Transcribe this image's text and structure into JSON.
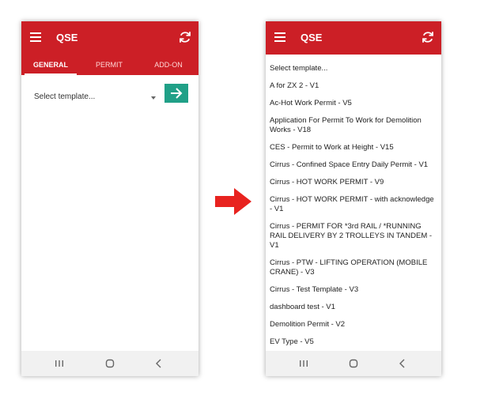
{
  "left_screen": {
    "app_title": "QSE",
    "tabs": [
      {
        "label": "GENERAL",
        "active": true
      },
      {
        "label": "PERMIT",
        "active": false
      },
      {
        "label": "ADD-ON",
        "active": false
      }
    ],
    "select_placeholder": "Select template..."
  },
  "right_screen": {
    "app_title": "QSE",
    "templates": [
      "Select template...",
      "A for ZX 2 - V1",
      "Ac-Hot Work Permit - V5",
      "Application For Permit To Work for Demolition Works - V18",
      "CES - Permit to Work at Height - V15",
      "Cirrus - Confined Space Entry Daily Permit - V1",
      "Cirrus - HOT WORK PERMIT - V9",
      "Cirrus - HOT WORK PERMIT - with acknowledge - V1",
      "Cirrus - PERMIT FOR *3rd RAIL / *RUNNING RAIL DELIVERY BY 2 TROLLEYS IN TANDEM - V1",
      "Cirrus - PTW - LIFTING OPERATION (MOBILE CRANE) - V3",
      "Cirrus - Test Template - V3",
      "dashboard test - V1",
      "Demolition Permit - V2",
      "EV Type - V5"
    ]
  },
  "colors": {
    "primary_red": "#cc1f26",
    "go_button": "#20a087",
    "arrow": "#e8231f"
  },
  "icons": [
    "menu-icon",
    "refresh-icon",
    "arrow-right-icon",
    "recents-icon",
    "home-icon",
    "back-icon"
  ]
}
